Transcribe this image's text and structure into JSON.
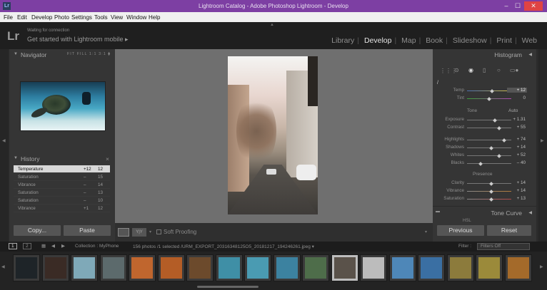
{
  "window": {
    "title": "Lightroom Catalog - Adobe Photoshop Lightroom - Develop",
    "app_icon": "Lr",
    "controls": {
      "minimize": "–",
      "maximize": "☐",
      "close": "✕"
    }
  },
  "menubar": {
    "items": [
      "File",
      "Edit",
      "Develop",
      "Photo",
      "Settings",
      "Tools",
      "View",
      "Window",
      "Help"
    ]
  },
  "identity": {
    "logo": "Lr",
    "status": "Waiting for connection",
    "mobile_label": "Get started with Lightroom mobile ▸"
  },
  "modules": [
    "Library",
    "Develop",
    "Map",
    "Book",
    "Slideshow",
    "Print",
    "Web"
  ],
  "navigator": {
    "title": "Navigator",
    "zoom": "FIT  FILL  1:1  3:1  ⧫"
  },
  "history": {
    "title": "History",
    "close": "×",
    "items": [
      {
        "name": "Temperature",
        "v1": "+12",
        "v2": "12",
        "selected": true
      },
      {
        "name": "Saturation",
        "v1": "–",
        "v2": "15"
      },
      {
        "name": "Vibrance",
        "v1": "–",
        "v2": "14"
      },
      {
        "name": "Saturation",
        "v1": "–",
        "v2": "13"
      },
      {
        "name": "Saturation",
        "v1": "–",
        "v2": "10"
      },
      {
        "name": "Vibrance",
        "v1": "+1",
        "v2": "12"
      }
    ]
  },
  "left_buttons": {
    "copy": "Copy...",
    "paste": "Paste"
  },
  "toolbar": {
    "soft_proofing": "Soft Proofing",
    "view_mode": "Y|Y"
  },
  "right_panel": {
    "histogram_title": "Histogram",
    "tone_curve_title": "Tone Curve",
    "hsl_label": "HSL",
    "temp": {
      "label": "Temp",
      "value": "+ 12",
      "pos": 0.57
    },
    "tint": {
      "label": "Tint",
      "value": "0",
      "pos": 0.5
    },
    "tone_label": "Tone",
    "auto_label": "Auto",
    "exposure": {
      "label": "Exposure",
      "value": "+ 1.31",
      "pos": 0.63
    },
    "contrast": {
      "label": "Contrast",
      "value": "+ 55",
      "pos": 0.74
    },
    "highlights": {
      "label": "Highlights",
      "value": "+ 74",
      "pos": 0.86
    },
    "shadows": {
      "label": "Shadows",
      "value": "+ 14",
      "pos": 0.56
    },
    "whites": {
      "label": "Whites",
      "value": "+ 52",
      "pos": 0.74
    },
    "blacks": {
      "label": "Blacks",
      "value": "– 40",
      "pos": 0.3
    },
    "presence_label": "Presence",
    "clarity": {
      "label": "Clarity",
      "value": "+ 14",
      "pos": 0.56
    },
    "vibrance": {
      "label": "Vibrance",
      "value": "+ 14",
      "pos": 0.56
    },
    "saturation": {
      "label": "Saturation",
      "value": "+ 13",
      "pos": 0.56
    },
    "previous": "Previous",
    "reset": "Reset"
  },
  "filmbar": {
    "page1": "1",
    "page2": "2",
    "collection": "Collection : MyPhone",
    "info": "156 photos /1 selected /URM_EXPORT_20316348125O5_20181217_194246261.jpeg ▾",
    "filter_label": "Filter :",
    "filter_value": "Filters Off"
  },
  "thumbnails": [
    {
      "color": "#1e2428",
      "selected": false
    },
    {
      "color": "#3a2b25",
      "selected": false
    },
    {
      "color": "#7fa9b8",
      "selected": false
    },
    {
      "color": "#5c6a6c",
      "selected": false
    },
    {
      "color": "#c0662e",
      "selected": false
    },
    {
      "color": "#b45d26",
      "selected": false
    },
    {
      "color": "#6c4a2c",
      "selected": false
    },
    {
      "color": "#3f8fa6",
      "selected": false
    },
    {
      "color": "#4a9bb2",
      "selected": false
    },
    {
      "color": "#3c82a0",
      "selected": false
    },
    {
      "color": "#4e6d4a",
      "selected": false
    },
    {
      "color": "#5a524a",
      "selected": true
    },
    {
      "color": "#bcbcbc",
      "selected": false
    },
    {
      "color": "#4e87b8",
      "selected": false
    },
    {
      "color": "#3a6fa3",
      "selected": false
    },
    {
      "color": "#8c7b3c",
      "selected": false
    },
    {
      "color": "#9b8a3a",
      "selected": false
    },
    {
      "color": "#a46a2a",
      "selected": false
    }
  ],
  "colors": {
    "titlebar": "#7d3fa3",
    "close": "#e04343",
    "selection": "#d8d8d8"
  }
}
